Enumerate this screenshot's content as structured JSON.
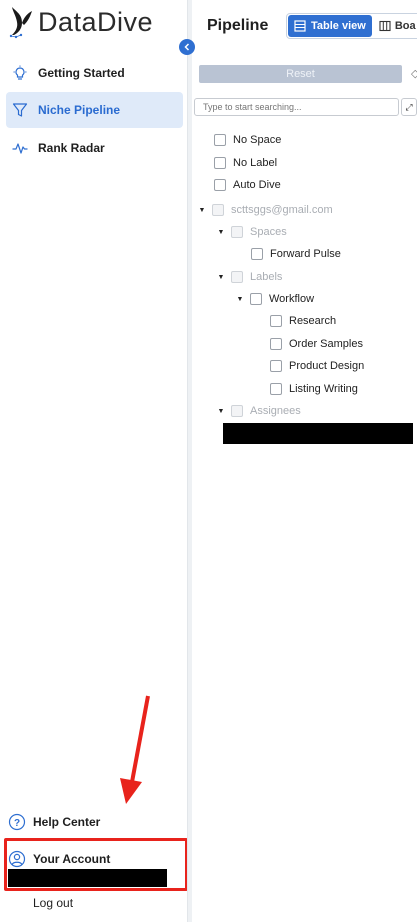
{
  "brand": {
    "name": "DataDive"
  },
  "sidebar": {
    "items": [
      {
        "label": "Getting Started",
        "icon": "lightbulb-icon",
        "active": false
      },
      {
        "label": "Niche Pipeline",
        "icon": "filter-icon",
        "active": true
      },
      {
        "label": "Rank Radar",
        "icon": "pulse-icon",
        "active": false
      }
    ],
    "help_label": "Help Center",
    "account_label": "Your Account",
    "logout_label": "Log out"
  },
  "header": {
    "title": "Pipeline",
    "views": [
      {
        "label": "Table view",
        "icon": "table-icon",
        "active": true
      },
      {
        "label": "Boa",
        "icon": "board-icon",
        "active": false
      }
    ]
  },
  "filters": {
    "reset_label": "Reset",
    "search_placeholder": "Type to start searching...",
    "top_options": [
      "No Space",
      "No Label",
      "Auto Dive"
    ],
    "account_email": "scttsggs@gmail.com",
    "spaces_label": "Spaces",
    "spaces": [
      "Forward Pulse"
    ],
    "labels_label": "Labels",
    "workflow_label": "Workflow",
    "workflow_items": [
      "Research",
      "Order Samples",
      "Product Design",
      "Listing Writing"
    ],
    "assignees_label": "Assignees"
  },
  "colors": {
    "accent": "#2f6fd1",
    "active_bg": "#dfeaf9",
    "annotation_red": "#e8231c"
  }
}
